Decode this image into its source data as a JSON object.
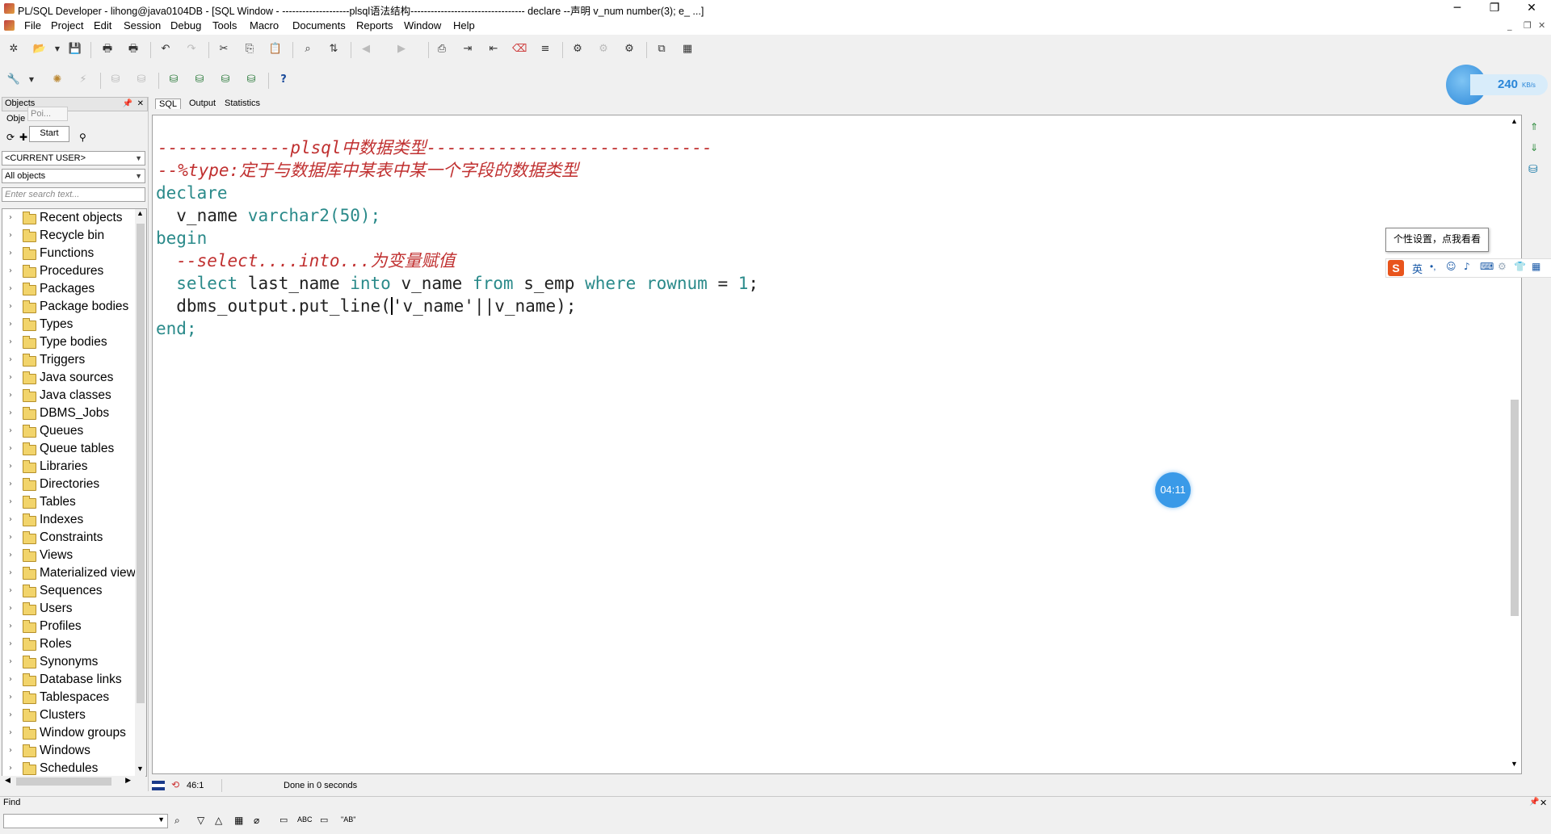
{
  "window": {
    "title": "PL/SQL Developer - lihong@java0104DB - [SQL Window - --------------------plsql语法结构---------------------------------- declare --声明 v_num number(3); e_ ...]",
    "minimize": "─",
    "maximize": "❐",
    "close": "✕"
  },
  "menu": [
    {
      "label": "File"
    },
    {
      "label": "Project"
    },
    {
      "label": "Edit"
    },
    {
      "label": "Session"
    },
    {
      "label": "Debug"
    },
    {
      "label": "Tools"
    },
    {
      "label": "Macro"
    },
    {
      "label": "Documents"
    },
    {
      "label": "Reports"
    },
    {
      "label": "Window"
    },
    {
      "label": "Help"
    }
  ],
  "left_panel": {
    "header": "Objects",
    "sub_header": "Obje",
    "popup_poi": "Poi...",
    "popup_start": "Start",
    "user_dropdown": "<CURRENT USER>",
    "filter_dropdown": "All objects",
    "search_placeholder": "Enter search text...",
    "tree_items": [
      "Recent objects",
      "Recycle bin",
      "Functions",
      "Procedures",
      "Packages",
      "Package bodies",
      "Types",
      "Type bodies",
      "Triggers",
      "Java sources",
      "Java classes",
      "DBMS_Jobs",
      "Queues",
      "Queue tables",
      "Libraries",
      "Directories",
      "Tables",
      "Indexes",
      "Constraints",
      "Views",
      "Materialized views",
      "Sequences",
      "Users",
      "Profiles",
      "Roles",
      "Synonyms",
      "Database links",
      "Tablespaces",
      "Clusters",
      "Window groups",
      "Windows",
      "Schedules"
    ]
  },
  "editor": {
    "tabs": [
      "SQL",
      "Output",
      "Statistics"
    ],
    "code": {
      "line1": "-------------plsql中数据类型----------------------------",
      "line2": "--%type:定于与数据库中某表中某一个字段的数据类型",
      "line3_kw": "declare",
      "line4_id": "  v_name ",
      "line4_type": "varchar2(50);",
      "line5_kw": "begin",
      "line6_cm": "  --select....into...为变量赋值",
      "line7": {
        "a": "  select",
        "b": " last_name ",
        "c": "into",
        "d": " v_name ",
        "e": "from",
        "f": " s_emp ",
        "g": "where",
        "h": " ",
        "i": "rownum",
        "j": " = ",
        "k": "1",
        "l": ";"
      },
      "line8_a": "  dbms_output.put_line(",
      "line8_b": "'v_name'",
      "line8_c": "||v_name);",
      "line9_kw": "end;"
    }
  },
  "status": {
    "position": "46:1",
    "message": "Done in 0 seconds"
  },
  "find_bar": {
    "label": "Find",
    "input_value": "",
    "abc_label": "ABC",
    "ab_label": "\"AB\""
  },
  "floating": {
    "speed": "240",
    "speed_unit": "KB/s",
    "tooltip": "个性设置，点我看看",
    "ime_lang": "英",
    "timer": "04:11"
  },
  "colors": {
    "comment": "#c03030",
    "keyword": "#2a8a8a",
    "timer_bg": "#3a9ae8"
  }
}
